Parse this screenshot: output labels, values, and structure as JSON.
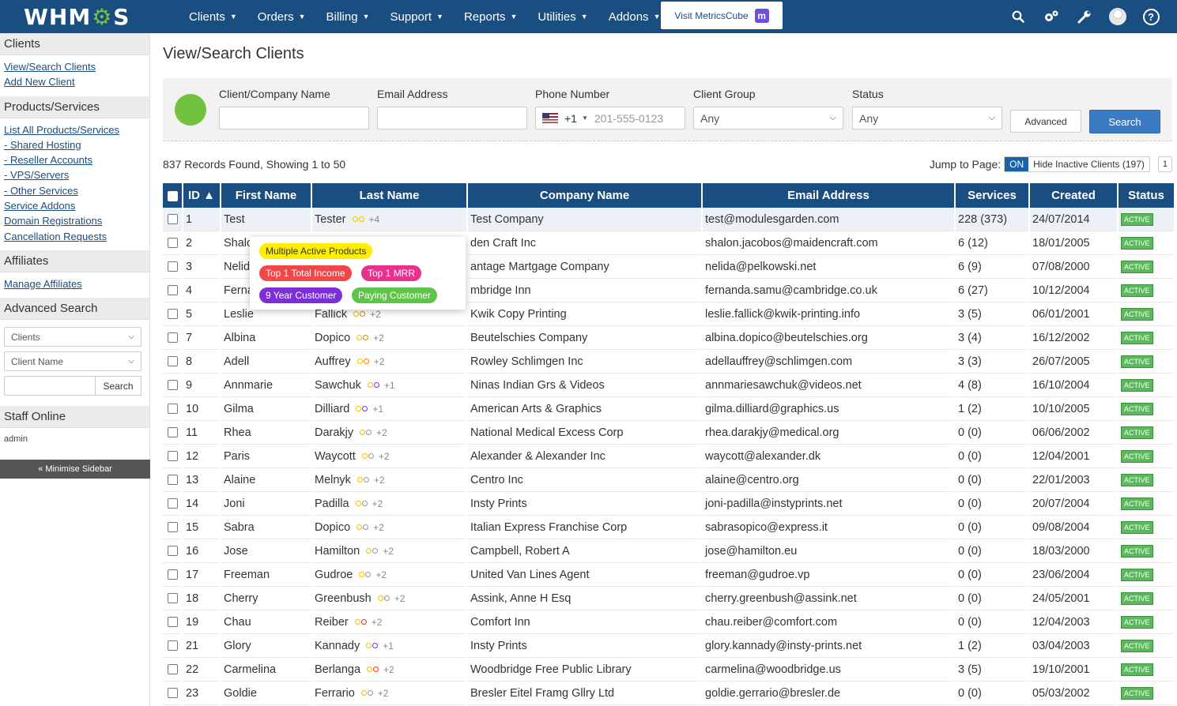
{
  "app": {
    "logo_left": "WHM",
    "logo_gear": "⚙",
    "logo_right": "S"
  },
  "nav": {
    "items": [
      "Clients",
      "Orders",
      "Billing",
      "Support",
      "Reports",
      "Utilities",
      "Addons"
    ],
    "metrics_label": "Visit MetricsCube",
    "metrics_badge": "m",
    "icons": [
      "search-icon",
      "cogs-icon",
      "wrench-icon",
      "user-avatar",
      "help-icon"
    ]
  },
  "sidebar": {
    "clients_head": "Clients",
    "clients_links": [
      "View/Search Clients",
      "Add New Client"
    ],
    "products_head": "Products/Services",
    "products_links": [
      "List All Products/Services",
      "- Shared Hosting",
      "- Reseller Accounts",
      "- VPS/Servers",
      "- Other Services",
      "Service Addons",
      "Domain Registrations",
      "Cancellation Requests"
    ],
    "affiliates_head": "Affiliates",
    "affiliates_links": [
      "Manage Affiliates"
    ],
    "adv_head": "Advanced Search",
    "adv_select1": "Clients",
    "adv_select2": "Client Name",
    "adv_search_btn": "Search",
    "staff_head": "Staff Online",
    "staff_name": "admin",
    "minimise": "« Minimise Sidebar"
  },
  "main": {
    "title": "View/Search Clients",
    "filters": {
      "name_label": "Client/Company Name",
      "email_label": "Email Address",
      "phone_label": "Phone Number",
      "phone_code": "+1",
      "phone_placeholder": "201-555-0123",
      "group_label": "Client Group",
      "group_value": "Any",
      "status_label": "Status",
      "status_value": "Any",
      "advanced_btn": "Advanced",
      "search_btn": "Search"
    },
    "records": "837 Records Found, Showing 1 to 50",
    "jump_label": "Jump to Page:",
    "toggle_on": "ON",
    "toggle_label": "Hide Inactive Clients (197)",
    "page_num": "1"
  },
  "table": {
    "headers": [
      "ID ▲",
      "First Name",
      "Last Name",
      "Company Name",
      "Email Address",
      "Services",
      "Created",
      "Status"
    ],
    "rows": [
      {
        "id": "1",
        "first": "Test",
        "last": "Tester",
        "plus": "+4",
        "company": "Test Company",
        "email": "test@modulesgarden.com",
        "services": "228 (373)",
        "created": "24/07/2014",
        "status": "ACTIVE",
        "d1": "#f0c000",
        "d2": "#f0c000"
      },
      {
        "id": "2",
        "first": "Shalo",
        "last": "",
        "plus": "",
        "company": "den Craft Inc",
        "email": "shalon.jacobos@maidencraft.com",
        "services": "6 (12)",
        "created": "18/01/2005",
        "status": "ACTIVE",
        "d1": "",
        "d2": ""
      },
      {
        "id": "3",
        "first": "Nelid",
        "last": "",
        "plus": "",
        "company": "antage Martgage Company",
        "email": "nelida@pelkowski.net",
        "services": "6 (9)",
        "created": "07/08/2000",
        "status": "ACTIVE",
        "d1": "",
        "d2": ""
      },
      {
        "id": "4",
        "first": "Ferna",
        "last": "",
        "plus": "",
        "company": "mbridge Inn",
        "email": "fernanda.samu@cambridge.co.uk",
        "services": "6 (27)",
        "created": "10/12/2004",
        "status": "ACTIVE",
        "d1": "",
        "d2": ""
      },
      {
        "id": "5",
        "first": "Leslie",
        "last": "Fallick",
        "plus": "+2",
        "company": "Kwik Copy Printing",
        "email": "leslie.fallick@kwik-printing.info",
        "services": "3 (5)",
        "created": "06/01/2001",
        "status": "ACTIVE",
        "d1": "#f0c000",
        "d2": "#f08000"
      },
      {
        "id": "7",
        "first": "Albina",
        "last": "Dopico",
        "plus": "+2",
        "company": "Beutelschies Company",
        "email": "albina.dopico@beutelschies.org",
        "services": "3 (4)",
        "created": "16/12/2002",
        "status": "ACTIVE",
        "d1": "#f0c000",
        "d2": "#f08000"
      },
      {
        "id": "8",
        "first": "Adell",
        "last": "Auffrey",
        "plus": "+2",
        "company": "Rowley Schlimgen Inc",
        "email": "adellauffrey@schlimgen.com",
        "services": "3 (3)",
        "created": "26/07/2005",
        "status": "ACTIVE",
        "d1": "#f0c000",
        "d2": "#f08000"
      },
      {
        "id": "9",
        "first": "Annmarie",
        "last": "Sawchuk",
        "plus": "+1",
        "company": "Ninas Indian Grs & Videos",
        "email": "annmariesawchuk@videos.net",
        "services": "4 (8)",
        "created": "16/10/2004",
        "status": "ACTIVE",
        "d1": "#f0c000",
        "d2": "#7b2fd8"
      },
      {
        "id": "10",
        "first": "Gilma",
        "last": "Dilliard",
        "plus": "+1",
        "company": "American Arts & Graphics",
        "email": "gilma.dilliard@graphics.us",
        "services": "1 (2)",
        "created": "10/10/2005",
        "status": "ACTIVE",
        "d1": "#f0c000",
        "d2": "#7b2fd8"
      },
      {
        "id": "11",
        "first": "Rhea",
        "last": "Darakjy",
        "plus": "+2",
        "company": "National Medical Excess Corp",
        "email": "rhea.darakjy@medical.org",
        "services": "0 (0)",
        "created": "06/06/2002",
        "status": "ACTIVE",
        "d1": "#f0c000",
        "d2": "#999999"
      },
      {
        "id": "12",
        "first": "Paris",
        "last": "Waycott",
        "plus": "+2",
        "company": "Alexander & Alexander Inc",
        "email": "waycott@alexander.dk",
        "services": "0 (0)",
        "created": "12/04/2001",
        "status": "ACTIVE",
        "d1": "#f0c000",
        "d2": "#999999"
      },
      {
        "id": "13",
        "first": "Alaine",
        "last": "Melnyk",
        "plus": "+2",
        "company": "Centro Inc",
        "email": "alaine@centro.org",
        "services": "0 (0)",
        "created": "22/01/2003",
        "status": "ACTIVE",
        "d1": "#f0c000",
        "d2": "#999999"
      },
      {
        "id": "14",
        "first": "Joni",
        "last": "Padilla",
        "plus": "+2",
        "company": "Insty Prints",
        "email": "joni-padilla@instyprints.net",
        "services": "0 (0)",
        "created": "20/07/2004",
        "status": "ACTIVE",
        "d1": "#f0c000",
        "d2": "#999999"
      },
      {
        "id": "15",
        "first": "Sabra",
        "last": "Dopico",
        "plus": "+2",
        "company": "Italian Express Franchise Corp",
        "email": "sabrasopico@express.it",
        "services": "0 (0)",
        "created": "09/08/2004",
        "status": "ACTIVE",
        "d1": "#f0c000",
        "d2": "#999999"
      },
      {
        "id": "16",
        "first": "Jose",
        "last": "Hamilton",
        "plus": "+2",
        "company": "Campbell, Robert A",
        "email": "jose@hamilton.eu",
        "services": "0 (0)",
        "created": "18/03/2000",
        "status": "ACTIVE",
        "d1": "#f0c000",
        "d2": "#999999"
      },
      {
        "id": "17",
        "first": "Freeman",
        "last": "Gudroe",
        "plus": "+2",
        "company": "United Van Lines Agent",
        "email": "freeman@gudroe.vp",
        "services": "0 (0)",
        "created": "23/06/2004",
        "status": "ACTIVE",
        "d1": "#f0c000",
        "d2": "#999999"
      },
      {
        "id": "18",
        "first": "Cherry",
        "last": "Greenbush",
        "plus": "+2",
        "company": "Assink, Anne H Esq",
        "email": "cherry.greenbush@assink.net",
        "services": "0 (0)",
        "created": "24/05/2001",
        "status": "ACTIVE",
        "d1": "#f0c000",
        "d2": "#999999"
      },
      {
        "id": "19",
        "first": "Chau",
        "last": "Reiber",
        "plus": "+2",
        "company": "Comfort Inn",
        "email": "chau.reiber@comfort.com",
        "services": "0 (0)",
        "created": "12/04/2003",
        "status": "ACTIVE",
        "d1": "#f0c000",
        "d2": "#f03030"
      },
      {
        "id": "21",
        "first": "Glory",
        "last": "Kannady",
        "plus": "+1",
        "company": "Insty Prints",
        "email": "glory.kannady@insty-prints.net",
        "services": "1 (2)",
        "created": "03/04/2003",
        "status": "ACTIVE",
        "d1": "#f0c000",
        "d2": "#7b2fd8"
      },
      {
        "id": "22",
        "first": "Carmelina",
        "last": "Berlanga",
        "plus": "+2",
        "company": "Woodbridge Free Public Library",
        "email": "carmelina@woodbridge.us",
        "services": "3 (5)",
        "created": "19/10/2001",
        "status": "ACTIVE",
        "d1": "#f0c000",
        "d2": "#f03030"
      },
      {
        "id": "23",
        "first": "Goldie",
        "last": "Ferrario",
        "plus": "+2",
        "company": "Bresler Eitel Framg Gllry Ltd",
        "email": "goldie.gerrario@bresler.de",
        "services": "0 (0)",
        "created": "05/03/2002",
        "status": "ACTIVE",
        "d1": "#f0c000",
        "d2": "#999999"
      }
    ]
  },
  "popover": {
    "pills": [
      {
        "label": "Multiple Active Products",
        "bg": "#ffee00",
        "fg": "#333333"
      },
      {
        "label": "Top 1 Total Income",
        "bg": "#f04848",
        "fg": "#ffffff"
      },
      {
        "label": "Top 1 MRR",
        "bg": "#e8308c",
        "fg": "#ffffff"
      },
      {
        "label": "9 Year Customer",
        "bg": "#7b2fd8",
        "fg": "#ffffff"
      },
      {
        "label": "Paying Customer",
        "bg": "#5fc44a",
        "fg": "#ffffff"
      }
    ]
  }
}
